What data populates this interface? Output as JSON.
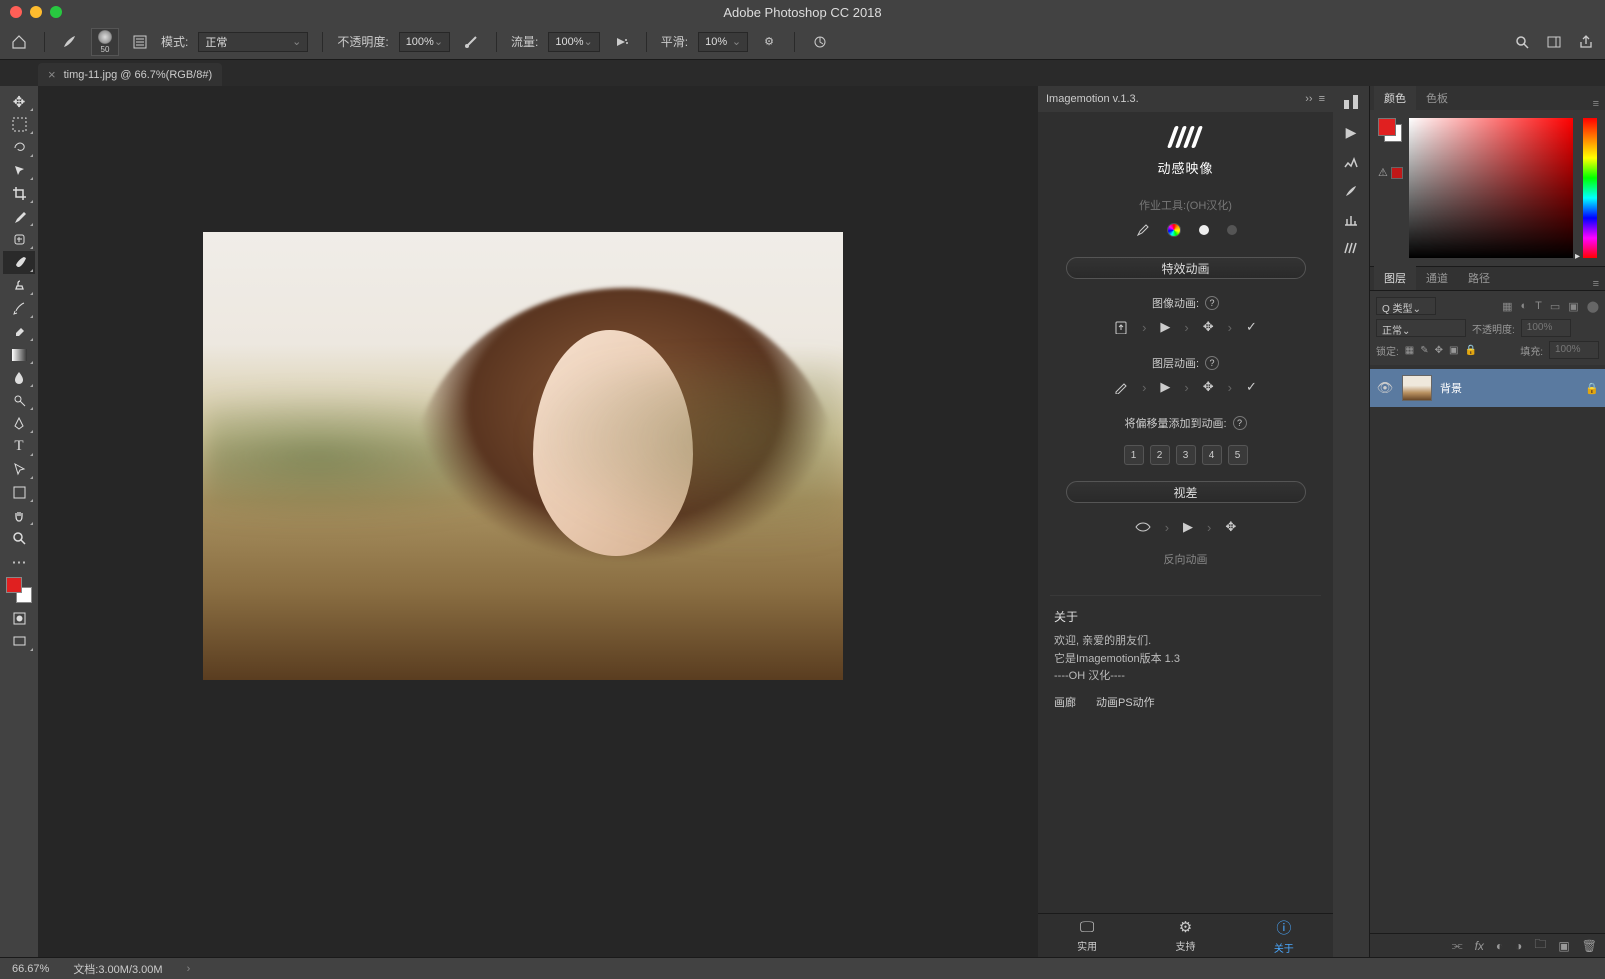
{
  "app": {
    "title": "Adobe Photoshop CC 2018"
  },
  "traffic": {
    "close": "#ff5f57",
    "min": "#febc2e",
    "max": "#28c840"
  },
  "optbar": {
    "brush_size": "50",
    "mode_label": "模式:",
    "mode_value": "正常",
    "opacity_label": "不透明度:",
    "opacity_value": "100%",
    "flow_label": "流量:",
    "flow_value": "100%",
    "smooth_label": "平滑:",
    "smooth_value": "10%"
  },
  "tab": {
    "close": "×",
    "title": "timg-11.jpg @ 66.7%(RGB/8#)"
  },
  "plugin": {
    "header": "Imagemotion v.1.3.",
    "logo_text": "动感映像",
    "worktools": "作业工具:(OH汉化)",
    "effects_header": "特效动画",
    "image_anim": "图像动画:",
    "layer_anim": "图层动画:",
    "offset_anim": "将偏移量添加到动画:",
    "offsets": [
      "1",
      "2",
      "3",
      "4",
      "5"
    ],
    "parallax_header": "视差",
    "reverse": "反向动画",
    "about_title": "关于",
    "about_l1": "欢迎, 亲爱的朋友们.",
    "about_l2": "它是Imagemotion版本 1.3",
    "about_l3": "----OH 汉化----",
    "link_gallery": "画廊",
    "link_actions": "动画PS动作",
    "footer": {
      "useful": "实用",
      "support": "支持",
      "about": "关于"
    }
  },
  "colorpanel": {
    "tab_color": "颜色",
    "tab_swatches": "色板"
  },
  "layerspanel": {
    "tab_layers": "图层",
    "tab_channels": "通道",
    "tab_paths": "路径",
    "kind": "Q 类型",
    "blend": "正常",
    "opacity_label": "不透明度:",
    "opacity_value": "100%",
    "lock_label": "锁定:",
    "fill_label": "填充:",
    "fill_value": "100%",
    "layer_name": "背景"
  },
  "status": {
    "zoom": "66.67%",
    "docinfo": "文档:3.00M/3.00M"
  }
}
